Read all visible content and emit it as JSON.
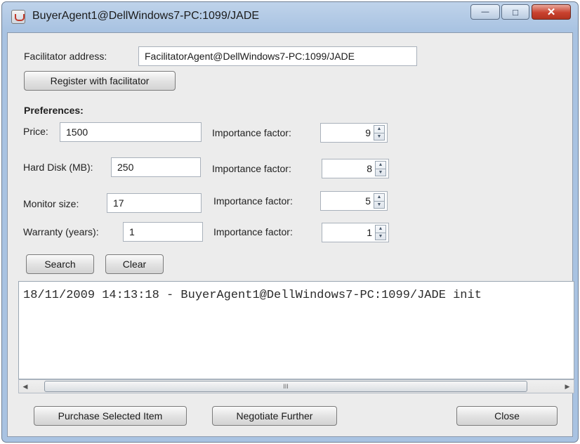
{
  "window": {
    "title": "BuyerAgent1@DellWindows7-PC:1099/JADE",
    "minimize_glyph": "—",
    "maximize_glyph": "□",
    "close_glyph": "✕"
  },
  "facilitator": {
    "label": "Facilitator address:",
    "value": "FacilitatorAgent@DellWindows7-PC:1099/JADE",
    "register_button": "Register with facilitator"
  },
  "preferences": {
    "heading": "Preferences:",
    "importance_label": "Importance factor:",
    "rows": [
      {
        "label": "Price:",
        "value": "1500",
        "importance": "9"
      },
      {
        "label": "Hard Disk (MB):",
        "value": "250",
        "importance": "8"
      },
      {
        "label": "Monitor size:",
        "value": "17",
        "importance": "5"
      },
      {
        "label": "Warranty (years):",
        "value": "1",
        "importance": "1"
      }
    ]
  },
  "actions": {
    "search": "Search",
    "clear": "Clear"
  },
  "log": {
    "lines": [
      "18/11/2009 14:13:18 - BuyerAgent1@DellWindows7-PC:1099/JADE init"
    ],
    "scroll_left": "◀",
    "scroll_right": "▶",
    "thumb_grip": "III"
  },
  "footer": {
    "purchase": "Purchase Selected Item",
    "negotiate": "Negotiate Further",
    "close": "Close"
  },
  "colors": {
    "titlebar": "#a9c3e2",
    "client_bg": "#ececec",
    "close_button": "#c9422f"
  }
}
